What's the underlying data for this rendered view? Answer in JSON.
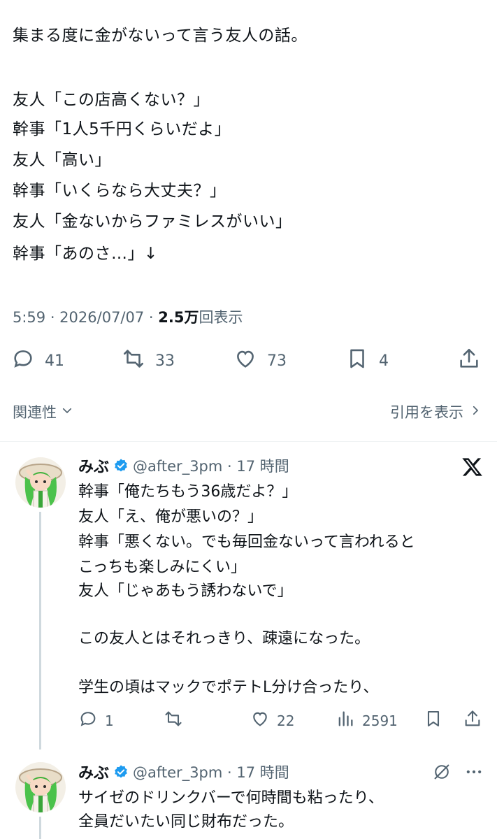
{
  "tweet": {
    "lines": [
      "集まる度に金がないって言う友人の話。",
      "友人「この店高くない？」",
      "幹事「1人5千円くらいだよ」",
      "友人「高い」",
      "幹事「いくらなら大丈夫？」",
      "友人「金ないからファミレスがいい」",
      "幹事「あのさ…」↓"
    ],
    "time": "5:59 · 2026/07/07 · ",
    "views": "2.5万",
    "views_suffix": "回表示",
    "replies": "41",
    "retweets": "33",
    "likes": "73",
    "bookmarks": "4"
  },
  "links": {
    "related": "関連性",
    "quotes": "引用を表示"
  },
  "replies": [
    {
      "name": "みぶ",
      "handle": "@after_3pm · 17 時間",
      "lines": [
        "幹事「俺たちもう36歳だよ？」",
        "友人「え、俺が悪いの？」",
        "幹事「悪くない。でも毎回金ないって言われると",
        "こっちも楽しみにくい」",
        "友人「じゃあもう誘わないで」",
        "",
        "この友人とはそれっきり、疎遠になった。",
        "",
        "学生の頃はマックでポテトL分け合ったり、"
      ],
      "replies": "1",
      "likes": "22",
      "views": "2591"
    },
    {
      "name": "みぶ",
      "handle": "@after_3pm · 17 時間",
      "lines": [
        "サイゼのドリンクバーで何時間も粘ったり、",
        "全員だいたい同じ財布だった。"
      ]
    }
  ],
  "icons": {
    "reply": "reply-icon",
    "retweet": "retweet-icon",
    "like": "heart-icon",
    "bookmark": "bookmark-icon",
    "share": "share-icon",
    "views": "views-icon",
    "verified": "verified-badge-icon",
    "x_logo": "x-logo-icon",
    "grok": "grok-icon",
    "more": "more-icon",
    "chevron_down": "chevron-down-icon",
    "chevron_right": "chevron-right-icon"
  },
  "colors": {
    "text": "#0f1419",
    "secondary": "#536471",
    "verified": "#1d9bf0",
    "thread_line": "#cfd9de"
  }
}
